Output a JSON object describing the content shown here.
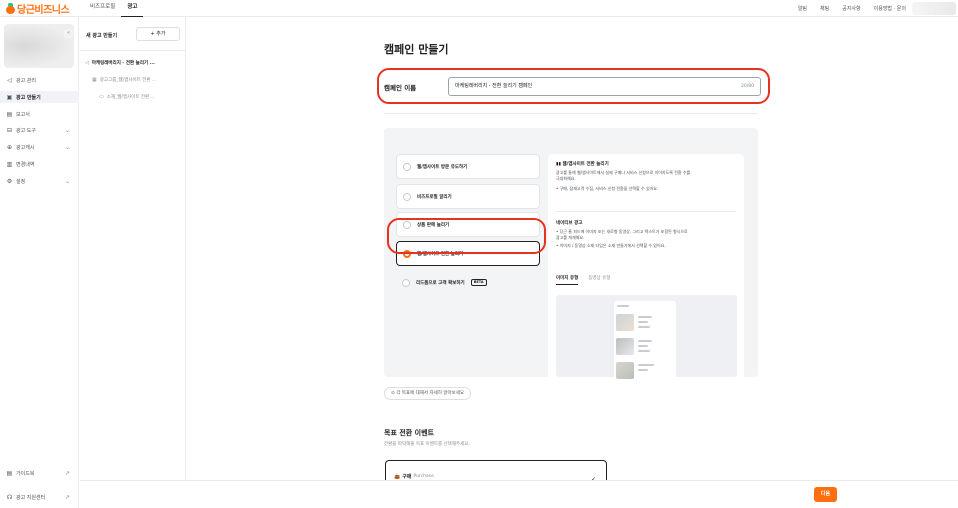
{
  "topbar": {
    "logo": "당근비즈니스",
    "nav": [
      "비즈프로필",
      "광고"
    ],
    "active_nav": "광고",
    "right_links": [
      "알림",
      "채팅",
      "공지사항",
      "이용방법 · 문의"
    ]
  },
  "sidebar": {
    "items": [
      {
        "icon": "megaphone-icon",
        "label": "광고 관리"
      },
      {
        "icon": "ad-create-icon",
        "label": "광고 만들기"
      },
      {
        "icon": "report-icon",
        "label": "보고서"
      },
      {
        "icon": "tools-icon",
        "label": "광고 도구"
      },
      {
        "icon": "cash-icon",
        "label": "광고캐시"
      },
      {
        "icon": "history-icon",
        "label": "변경내역"
      },
      {
        "icon": "settings-icon",
        "label": "설정"
      }
    ],
    "active_index": 1,
    "footer": [
      {
        "icon": "guide-icon",
        "label": "가이드북"
      },
      {
        "icon": "headset-icon",
        "label": "광고 지원센터"
      }
    ]
  },
  "panel": {
    "title": "새 광고 만들기",
    "add_button": "+ 추가",
    "tree": {
      "campaign": "마케팅레버리지 - 전환 늘리기 ...",
      "group": "광고그룹_웹/앱사이트 전환 ...",
      "ad": "소재_웹/앱사이트 전환 ..."
    }
  },
  "main": {
    "page_title": "캠페인 만들기",
    "name_label": "캠페인 이름",
    "name_value": "마케팅레버리지 - 전환 늘리기 캠페인",
    "name_count": "20/80",
    "options": [
      "웹/앱사이트 방문 유도하기",
      "비즈프로필 알리기",
      "상품 판매 늘리기",
      "웹/앱사이트 전환 늘리기",
      "리드폼으로 고객 확보하기"
    ],
    "selected_option": 3,
    "beta_label": "BETA",
    "detail": {
      "title": "웹/앱사이트 전환 늘리기",
      "desc_lines": [
        "광고를 통해 웹/앱사이트에서 실제 구매나 서비스 신청으로 이어지도록 전환 수를",
        "극대화해요."
      ],
      "bullet": "• 구매, 잠재고객 수집, 서비스 신청 전환을 선택할 수 있어요.",
      "native_title": "네이티브 광고",
      "native_lines": [
        "• 당근 홈 피드에 이미지 또는 새로형 동영상, 그리고 텍스트가 포함된 형식으로",
        "   광고를 게재해요.",
        "• 이미지 / 동영상 소재 타입은 소재 만들기에서 선택할 수 있어요."
      ],
      "tabs": [
        "이미지 유형",
        "동영상 유형"
      ],
      "active_tab": 0
    },
    "help_button": "⊙ 각 목표에 대해서 자세히 알아보세요",
    "conversion_title": "목표 전환 이벤트",
    "conversion_sub": "전환을 파악해줄 목표 이벤트를 선택해주세요.",
    "conversion_option": {
      "label": "구매",
      "en": "Purchase"
    },
    "next_button": "다음"
  }
}
